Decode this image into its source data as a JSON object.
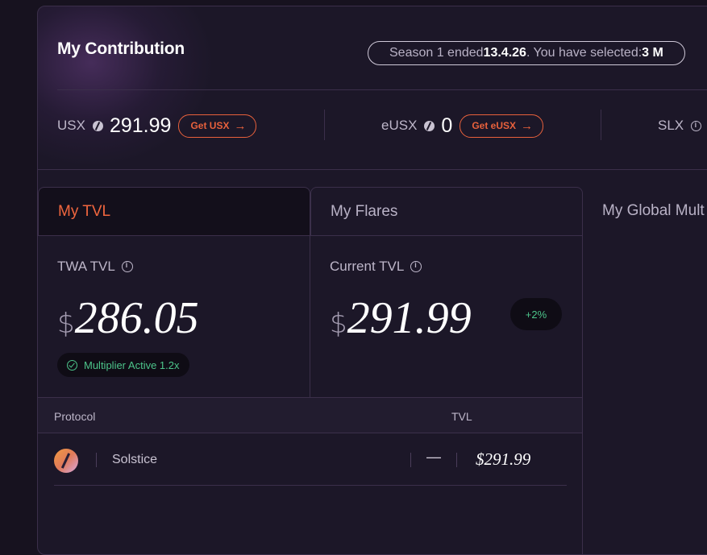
{
  "header": {
    "title": "My Contribution",
    "season_prefix": "Season 1 ended ",
    "season_date": "13.4.26",
    "season_suffix": ". You have selected: ",
    "season_selected": "3 M"
  },
  "tokens": [
    {
      "name": "USX",
      "value": "291.99",
      "button": "Get USX"
    },
    {
      "name": "eUSX",
      "value": "0",
      "button": "Get eUSX"
    },
    {
      "name": "SLX"
    }
  ],
  "tabs": {
    "tvl": "My TVL",
    "flares": "My Flares",
    "global": "My Global Mult"
  },
  "cards": {
    "twa": {
      "label": "TWA TVL",
      "currency": "$",
      "value": "286.05",
      "badge": "Multiplier Active 1.2x"
    },
    "current": {
      "label": "Current TVL",
      "currency": "$",
      "value": "291.99",
      "change": "+2%"
    }
  },
  "table": {
    "headers": {
      "protocol": "Protocol",
      "tvl": "TVL"
    },
    "rows": [
      {
        "protocol": "Solstice",
        "change": "—",
        "tvl": "$291.99"
      }
    ]
  },
  "colors": {
    "accent": "#e8613c",
    "positive": "#4cc48a",
    "background": "#17121f"
  }
}
